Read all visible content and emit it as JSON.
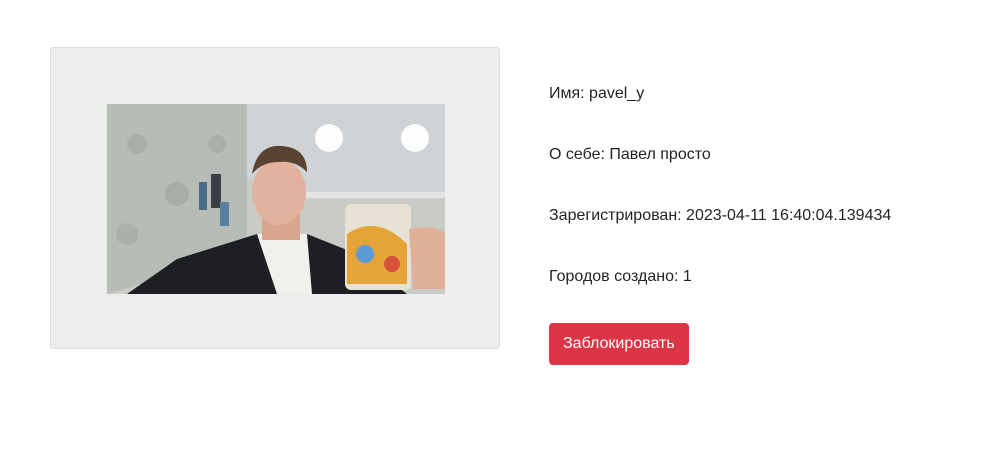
{
  "user": {
    "photo_alt": "Фото пользователя",
    "name_label": "Имя: pavel_y",
    "about_label": "О себе: Павел просто",
    "registered_label": "Зарегистрирован: 2023-04-11 16:40:04.139434",
    "cities_label": "Городов создано: 1"
  },
  "actions": {
    "block_label": "Заблокировать"
  },
  "colors": {
    "danger": "#dc3545",
    "card_bg": "#ededed"
  }
}
